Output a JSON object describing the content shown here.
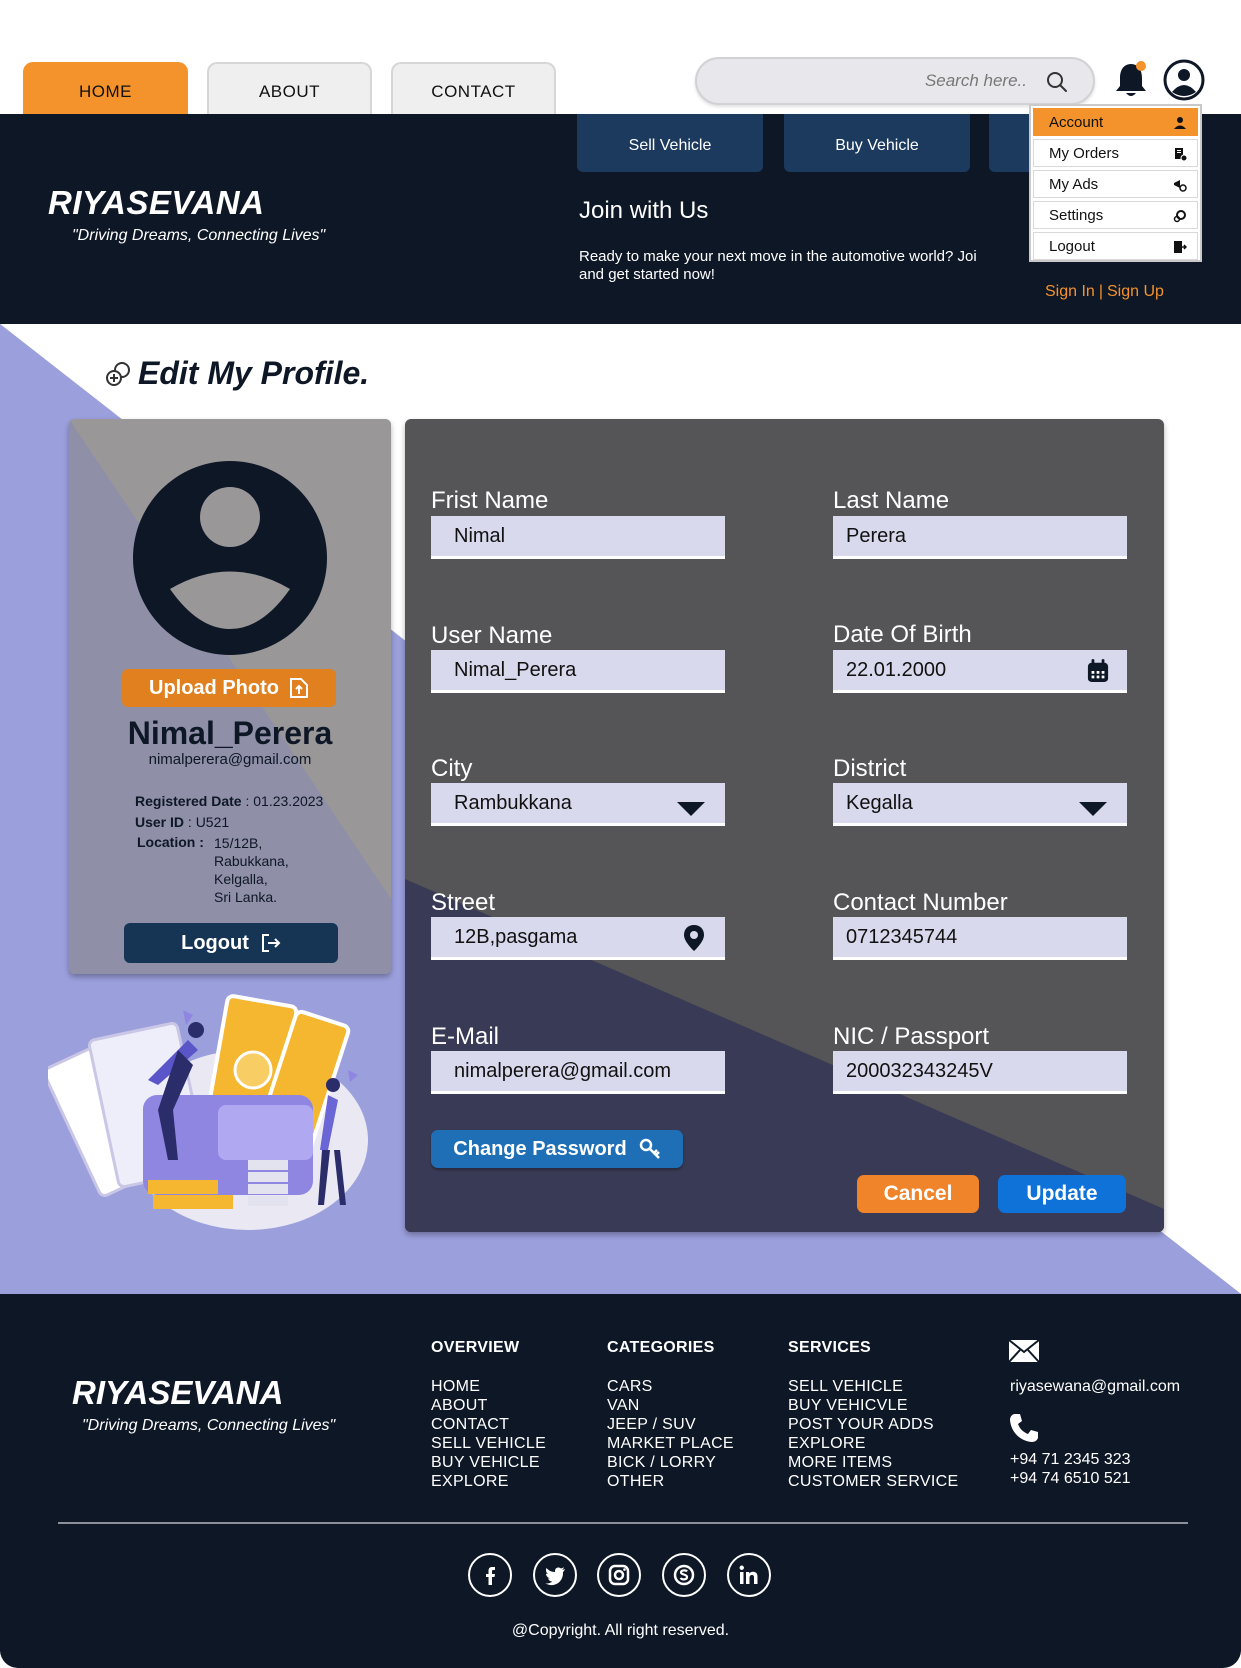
{
  "nav": {
    "tabs": [
      "HOME",
      "ABOUT",
      "CONTACT"
    ],
    "active_tab": "HOME",
    "search_placeholder": "Search here.."
  },
  "header": {
    "brand": "RIYASEVANA",
    "tagline": "\"Driving Dreams, Connecting Lives\"",
    "buttons": [
      "Sell Vehicle",
      "Buy Vehicle"
    ],
    "join_title": "Join with Us",
    "join_text_line1": "Ready to make your next move in the automotive world? Joi",
    "join_text_line2": "and get started now!",
    "sign_in": "Sign In",
    "sign_up": "Sign Up",
    "separator": "|"
  },
  "account_menu": {
    "items": [
      "Account",
      "My Orders",
      "My Ads",
      "Settings",
      "Logout"
    ],
    "active": "Account"
  },
  "page_title": "Edit My Profile.",
  "profile_card": {
    "upload_label": "Upload Photo",
    "username": "Nimal_Perera",
    "email": "nimalperera@gmail.com",
    "registered_label": "Registered Date",
    "registered_value": ": 01.23.2023",
    "userid_label": "User ID",
    "userid_value": ": U521",
    "location_label": "Location :",
    "location_lines": [
      "15/12B,",
      "Rabukkana,",
      "Kelgalla,",
      "Sri Lanka."
    ],
    "logout_label": "Logout"
  },
  "form": {
    "first_name_label": "Frist Name",
    "first_name": "Nimal",
    "last_name_label": "Last Name",
    "last_name": "Perera",
    "username_label": "User Name",
    "username": "Nimal_Perera",
    "dob_label": "Date Of Birth",
    "dob": "22.01.2000",
    "city_label": "City",
    "city": "Rambukkana",
    "district_label": "District",
    "district": "Kegalla",
    "street_label": "Street",
    "street": "12B,pasgama",
    "contact_label": "Contact Number",
    "contact": "0712345744",
    "email_label": "E-Mail",
    "email": "nimalperera@gmail.com",
    "nic_label": "NIC / Passport",
    "nic": "200032343245V",
    "change_password": "Change Password",
    "cancel": "Cancel",
    "update": "Update"
  },
  "footer": {
    "brand": "RIYASEVANA",
    "tagline": "\"Driving Dreams, Connecting Lives\"",
    "overview": {
      "title": "OVERVIEW",
      "items": [
        "HOME",
        "ABOUT",
        "CONTACT",
        "SELL VEHICLE",
        "BUY VEHICLE",
        "EXPLORE"
      ]
    },
    "categories": {
      "title": "CATEGORIES",
      "items": [
        "CARS",
        "VAN",
        "JEEP / SUV",
        "MARKET PLACE",
        "BICK / LORRY",
        "OTHER"
      ]
    },
    "services": {
      "title": "SERVICES",
      "items": [
        "SELL VEHICLE",
        "BUY VEHICVLE",
        "POST YOUR ADDS",
        "EXPLORE",
        "MORE ITEMS",
        "CUSTOMER SERVICE"
      ]
    },
    "email": "riyasewana@gmail.com",
    "phones": [
      "+94 71 2345 323",
      "+94 74 6510 521"
    ],
    "social_icons": [
      "facebook-icon",
      "twitter-icon",
      "instagram-icon",
      "skype-icon",
      "linkedin-icon"
    ],
    "copyright": "@Copyright. All right reserved."
  },
  "colors": {
    "accent_orange": "#f4922b",
    "navy": "#0e1726",
    "lavender": "#9b9fdc",
    "panel_gray": "#555557",
    "update_blue": "#0f72d8"
  }
}
